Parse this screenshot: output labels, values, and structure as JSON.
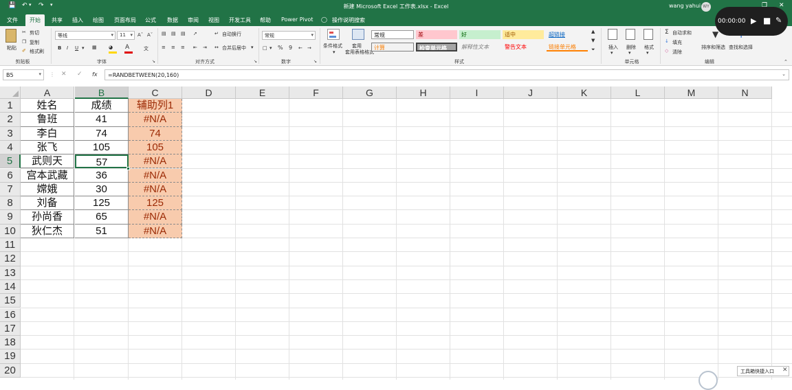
{
  "window": {
    "title": "新建 Microsoft Excel 工作表.xlsx  -  Excel",
    "user": "wang yahui",
    "avatar_initials": "WY",
    "brand_color": "#217346"
  },
  "tabs": [
    "文件",
    "开始",
    "共享",
    "插入",
    "绘图",
    "页面布局",
    "公式",
    "数据",
    "审阅",
    "视图",
    "开发工具",
    "帮助",
    "Power Pivot",
    "操作说明搜索"
  ],
  "ribbon": {
    "clipboard": {
      "paste": "粘贴",
      "cut": "剪切",
      "copy": "复制",
      "format_painter": "格式刷",
      "label": "剪贴板"
    },
    "font": {
      "name": "等线",
      "size": "11",
      "bold": "B",
      "italic": "I",
      "underline": "U",
      "label": "字体"
    },
    "alignment": {
      "wrap": "自动换行",
      "merge": "合并后居中",
      "label": "对齐方式"
    },
    "number": {
      "format": "常规",
      "percent": "%",
      "comma": "9",
      "label": "数字"
    },
    "styles": {
      "conditional": "条件格式",
      "table": "套用表格格式",
      "normal": "常规",
      "bad": "差",
      "good": "好",
      "neutral": "适中",
      "hyperlink": "超链接",
      "calc": "计算",
      "check": "检查单元格",
      "explain": "解释性文本",
      "warning": "警告文本",
      "linked": "链接单元格",
      "label": "样式"
    },
    "cells": {
      "insert": "插入",
      "delete": "删除",
      "format": "格式",
      "label": "单元格"
    },
    "editing": {
      "autosum": "自动求和",
      "fill": "填充",
      "clear": "清除",
      "sort": "排序和筛选",
      "find": "查找和选择",
      "label": "编辑"
    }
  },
  "formula_bar": {
    "name_box": "B5",
    "formula": "=RANDBETWEEN(20,160)",
    "fx": "fx"
  },
  "sheet": {
    "columns": [
      "A",
      "B",
      "C",
      "D",
      "E",
      "F",
      "G",
      "H",
      "I",
      "J",
      "K",
      "L",
      "M",
      "N"
    ],
    "rows": [
      "1",
      "2",
      "3",
      "4",
      "5",
      "6",
      "7",
      "8",
      "9",
      "10",
      "11",
      "12",
      "13",
      "14",
      "15",
      "16",
      "17",
      "18",
      "19",
      "20"
    ],
    "headers": [
      "姓名",
      "成绩",
      "辅助列1"
    ],
    "data": [
      [
        "鲁班",
        "41",
        "#N/A"
      ],
      [
        "李白",
        "74",
        "74"
      ],
      [
        "张飞",
        "105",
        "105"
      ],
      [
        "武则天",
        "57",
        "#N/A"
      ],
      [
        "宫本武藏",
        "36",
        "#N/A"
      ],
      [
        "嫦娥",
        "30",
        "#N/A"
      ],
      [
        "刘备",
        "125",
        "125"
      ],
      [
        "孙尚香",
        "65",
        "#N/A"
      ],
      [
        "狄仁杰",
        "51",
        "#N/A"
      ]
    ],
    "highlight_color": "#f8cbad"
  },
  "recorder": {
    "time": "00:00:00"
  },
  "toolbox": {
    "label": "工具箱快捷入口"
  }
}
